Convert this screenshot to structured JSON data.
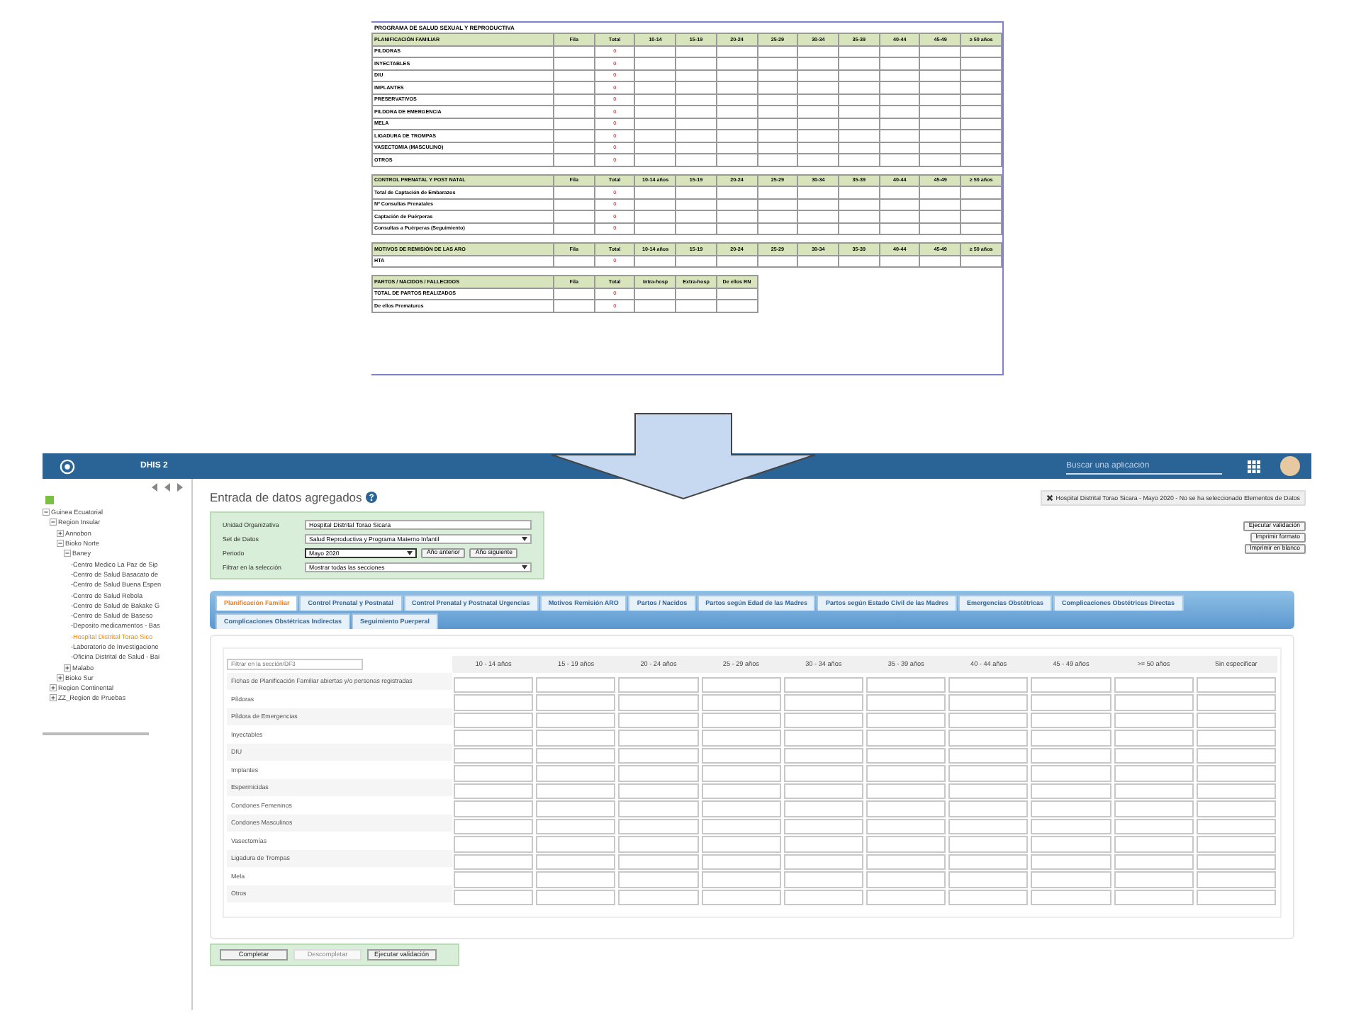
{
  "document": {
    "title": "PROGRAMA DE SALUD SEXUAL Y REPRODUCTIVA",
    "sections": [
      {
        "heading": "PLANIFICACIÓN FAMILIAR",
        "columns": [
          "Fila",
          "Total",
          "10-14",
          "15-19",
          "20-24",
          "25-29",
          "30-34",
          "35-39",
          "40-44",
          "45-49",
          "≥ 50 años"
        ],
        "rows": [
          {
            "label": "PILDORAS",
            "total": "0"
          },
          {
            "label": "INYECTABLES",
            "total": "0"
          },
          {
            "label": "DIU",
            "total": "0"
          },
          {
            "label": "IMPLANTES",
            "total": "0"
          },
          {
            "label": "PRESERVATIVOS",
            "total": "0"
          },
          {
            "label": "PILDORA DE EMERGENCIA",
            "total": "0"
          },
          {
            "label": "MELA",
            "total": "0"
          },
          {
            "label": "LIGADURA DE TROMPAS",
            "total": "0"
          },
          {
            "label": "VASECTOMIA (MASCULINO)",
            "total": "0"
          },
          {
            "label": "OTROS",
            "total": "0"
          }
        ]
      },
      {
        "heading": "CONTROL PRENATAL Y POST NATAL",
        "columns": [
          "Fila",
          "Total",
          "10-14 años",
          "15-19",
          "20-24",
          "25-29",
          "30-34",
          "35-39",
          "40-44",
          "45-49",
          "≥ 50 años"
        ],
        "rows": [
          {
            "label": "Total de Captación de Embarazos",
            "total": "0"
          },
          {
            "label": "Nº Consultas Prenatales",
            "total": "0"
          },
          {
            "label": "Captación de Puérperas",
            "total": "0"
          },
          {
            "label": "Consultas a Puérperas (Seguimiento)",
            "total": "0"
          }
        ]
      },
      {
        "heading": "MOTIVOS DE REMISIÓN DE LAS ARO",
        "columns": [
          "Fila",
          "Total",
          "10-14 años",
          "15-19",
          "20-24",
          "25-29",
          "30-34",
          "35-39",
          "40-44",
          "45-49",
          "≥ 50 años"
        ],
        "rows": [
          {
            "label": "HTA",
            "total": "0"
          }
        ]
      },
      {
        "heading": "PARTOS / NACIDOS / FALLECIDOS",
        "columns": [
          "Fila",
          "Total",
          "Intra-hosp",
          "Extra-hosp",
          "De ellos RN"
        ],
        "rows": [
          {
            "label": "TOTAL DE PARTOS REALIZADOS",
            "total": "0"
          },
          {
            "label": "De ellos Prematuros",
            "total": "0"
          }
        ]
      }
    ]
  },
  "header": {
    "brand": "DHIS 2",
    "search": {
      "placeholder": "Buscar una aplicación"
    }
  },
  "sidebar": {
    "tree": [
      {
        "label": "Guinea Ecuatorial",
        "expanded": true,
        "selected": false,
        "children": [
          {
            "label": "Region Insular",
            "expanded": true,
            "selected": false,
            "children": [
              {
                "label": "Annobon",
                "expanded": false,
                "selected": false
              },
              {
                "label": "Bioko Norte",
                "expanded": true,
                "selected": false,
                "children": [
                  {
                    "label": "Baney",
                    "expanded": true,
                    "selected": false,
                    "children": [
                      {
                        "label": "-Centro Medico La Paz de Sip",
                        "selected": false
                      },
                      {
                        "label": "-Centro de Salud Basacato de",
                        "selected": false
                      },
                      {
                        "label": "-Centro de Salud Buena Espen",
                        "selected": false
                      },
                      {
                        "label": "-Centro de Salud Rebola",
                        "selected": false
                      },
                      {
                        "label": "-Centro de Salud de Bakake G",
                        "selected": false
                      },
                      {
                        "label": "-Centro de Salud de Baseso",
                        "selected": false
                      },
                      {
                        "label": "-Deposito medicamentos - Bas",
                        "selected": false
                      },
                      {
                        "label": "-Hospital Distrital Torao Sico",
                        "selected": true
                      },
                      {
                        "label": "-Laboratorio de Investigacione",
                        "selected": false
                      },
                      {
                        "label": "-Oficina Distrital de Salud - Bai",
                        "selected": false
                      }
                    ]
                  },
                  {
                    "label": "Malabo",
                    "expanded": false,
                    "selected": false
                  }
                ]
              },
              {
                "label": "Bioko Sur",
                "expanded": false,
                "selected": false
              }
            ]
          },
          {
            "label": "Region Continental",
            "expanded": false,
            "selected": false
          },
          {
            "label": "ZZ_Region de Pruebas",
            "expanded": false,
            "selected": false
          }
        ]
      }
    ]
  },
  "main": {
    "title": "Entrada de datos agregados",
    "alert": "Hospital Distrital Torao Sicara - Mayo 2020 - No se ha seleccionado Elementos de Datos",
    "side_buttons": [
      "Ejecutar validación",
      "Imprimir formato",
      "Imprimir en blanco"
    ],
    "form": {
      "org_unit": {
        "label": "Unidad Organizativa",
        "value": "Hospital Distrital Torao Sicara"
      },
      "data_set": {
        "label": "Set de Datos",
        "value": "Salud Reproductiva y Programa Materno Infantil"
      },
      "period": {
        "label": "Periodo",
        "value": "Mayo 2020",
        "buttons": [
          "Año anterior",
          "Año siguiente"
        ]
      },
      "filter": {
        "label": "Filtrar en la selección",
        "value": "Mostrar todas las secciones"
      }
    },
    "tabs": [
      {
        "label": "Planificación Familiar",
        "selected": true
      },
      {
        "label": "Control Prenatal y Postnatal",
        "selected": false
      },
      {
        "label": "Control Prenatal y Postnatal Urgencias",
        "selected": false
      },
      {
        "label": "Motivos Remisión ARO",
        "selected": false
      },
      {
        "label": "Partos / Nacidos",
        "selected": false
      },
      {
        "label": "Partos según Edad de las Madres",
        "selected": false
      },
      {
        "label": "Partos según Estado Civil de las Madres",
        "selected": false
      },
      {
        "label": "Emergencias Obstétricas",
        "selected": false
      },
      {
        "label": "Complicaciones Obstétricas Directas",
        "selected": false
      },
      {
        "label": "Complicaciones Obstétricas Indirectas",
        "selected": false
      },
      {
        "label": "Seguimiento Puerperal",
        "selected": false
      }
    ],
    "table": {
      "filter": {
        "placeholder": "Filtrar en la sección/DF3"
      },
      "columns": [
        "10 - 14 años",
        "15 - 19 años",
        "20 - 24 años",
        "25 - 29 años",
        "30 - 34 años",
        "35 - 39 años",
        "40 - 44 años",
        "45 - 49 años",
        ">= 50 años",
        "Sin especificar"
      ],
      "rows": [
        "Fichas de Planificación Familiar abiertas y/o personas registradas",
        "Píldoras",
        "Píldora de Emergencias",
        "Inyectables",
        "DIU",
        "Implantes",
        "Espermicidas",
        "Condones Femeninos",
        "Condones Masculinos",
        "Vasectomías",
        "Ligadura de Trompas",
        "Mela",
        "Otros"
      ]
    },
    "bottom_buttons": [
      {
        "label": "Completar",
        "disabled": false
      },
      {
        "label": "Descompletar",
        "disabled": true
      },
      {
        "label": "Ejecutar validación",
        "disabled": false
      }
    ]
  }
}
